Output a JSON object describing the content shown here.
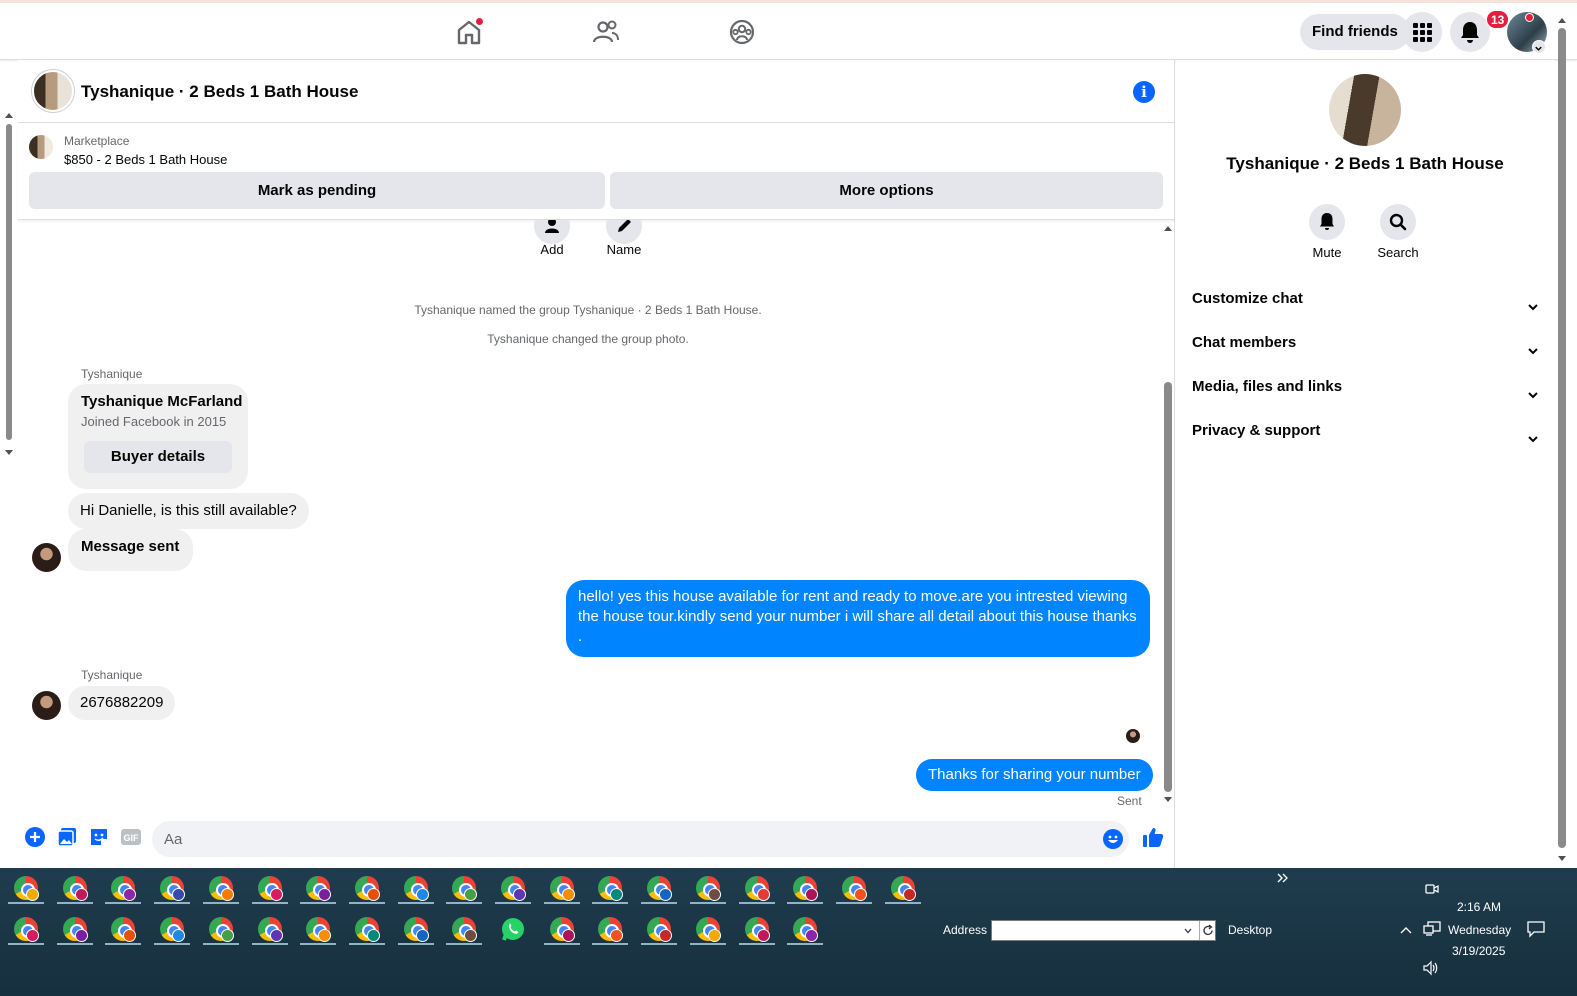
{
  "topnav": {
    "find_friends": "Find friends",
    "notifications_count": "13"
  },
  "chat": {
    "title": "Tyshanique · 2 Beds 1 Bath House",
    "marketplace": {
      "label": "Marketplace",
      "listing": "$850 - 2 Beds 1 Bath House",
      "mark_pending": "Mark as pending",
      "more_options": "More options"
    },
    "actions": {
      "add": "Add",
      "name": "Name"
    },
    "system_messages": [
      "Tyshanique named the group Tyshanique · 2 Beds 1 Bath House.",
      "Tyshanique changed the group photo."
    ],
    "sender_name": "Tyshanique",
    "buyer_card": {
      "name": "Tyshanique McFarland",
      "joined": "Joined Facebook in 2015",
      "button": "Buyer details"
    },
    "messages": {
      "m1": "Hi Danielle, is this still available?",
      "m2": "Message sent",
      "m3": "hello! yes this house available for rent and ready to move.are you intrested viewing the house tour.kindly send your number i will share all detail about this house thanks .",
      "m4": "2676882209",
      "m5": "Thanks for sharing your number",
      "status": "Sent"
    },
    "composer_placeholder": "Aa"
  },
  "side": {
    "title": "Tyshanique · 2 Beds 1 Bath House",
    "mute": "Mute",
    "search": "Search",
    "sections": [
      "Customize chat",
      "Chat members",
      "Media, files and links",
      "Privacy & support"
    ]
  },
  "taskbar": {
    "address_label": "Address",
    "desktop_label": "Desktop",
    "time": "2:16 AM",
    "day": "Wednesday",
    "date": "3/19/2025"
  },
  "colors": {
    "accent": "#0084ff",
    "brand_blue": "#0866ff",
    "badge_red": "#e41e3f"
  }
}
